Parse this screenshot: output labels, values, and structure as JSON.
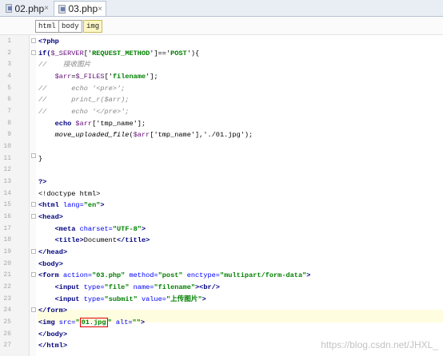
{
  "tabs": [
    {
      "label": "02.php",
      "active": false
    },
    {
      "label": "03.php",
      "active": true
    }
  ],
  "tab_close_glyph": "×",
  "breadcrumb": [
    "html",
    "body",
    "img"
  ],
  "line_numbers": [
    "1",
    "2",
    "3",
    "4",
    "5",
    "6",
    "7",
    "8",
    "9",
    "10",
    "11",
    "12",
    "13",
    "14",
    "15",
    "16",
    "17",
    "18",
    "19",
    "20",
    "21",
    "22",
    "23",
    "24",
    "25",
    "26",
    "27"
  ],
  "code": {
    "l1": "<?php",
    "l2a": "if(",
    "l2b": "$_SERVER",
    "l2c": "['",
    "l2d": "REQUEST_METHOD",
    "l2e": "']=='",
    "l2f": "POST",
    "l2g": "'){",
    "l3": "//    接收图片",
    "l4a": "    ",
    "l4b": "$arr",
    "l4c": "=",
    "l4d": "$_FILES",
    "l4e": "['",
    "l4f": "filename",
    "l4g": "'];",
    "l5": "//      echo '<pre>';",
    "l6": "//      print_r($arr);",
    "l7": "//      echo '</pre>';",
    "l8a": "    echo ",
    "l8b": "$arr",
    "l8c": "['tmp_name'];",
    "l9a": "    ",
    "l9b": "move_uploaded_file",
    "l9c": "(",
    "l9d": "$arr",
    "l9e": "['tmp_name'],'./01.jpg');",
    "l11": "}",
    "l13": "?>",
    "l14": "<!doctype html>",
    "l15a": "<html ",
    "l15b": "lang=",
    "l15c": "\"en\"",
    "l15d": ">",
    "l16": "<head>",
    "l17a": "    <meta ",
    "l17b": "charset=",
    "l17c": "\"UTF-8\"",
    "l17d": ">",
    "l18a": "    <title>",
    "l18b": "Document",
    "l18c": "</title>",
    "l19": "</head>",
    "l20": "<body>",
    "l21a": "<form ",
    "l21b": "action=",
    "l21c": "\"03.php\"",
    "l21d": " method=",
    "l21e": "\"post\"",
    "l21f": " enctype=",
    "l21g": "\"multipart/form-data\"",
    "l21h": ">",
    "l22a": "    <input ",
    "l22b": "type=",
    "l22c": "\"file\"",
    "l22d": " name=",
    "l22e": "\"filename\"",
    "l22f": "><br/>",
    "l23a": "    <input ",
    "l23b": "type=",
    "l23c": "\"submit\"",
    "l23d": " value=",
    "l23e": "\"上传图片\"",
    "l23f": ">",
    "l24": "</form>",
    "l25a": "<img ",
    "l25b": "src=",
    "l25c": "\"",
    "l25d": "01.jpg",
    "l25e": "\"",
    "l25f": " alt=",
    "l25g": "\"\"",
    "l25h": ">",
    "l26": "</body>",
    "l27": "</html>"
  },
  "watermark": "https://blog.csdn.net/JHXL_"
}
